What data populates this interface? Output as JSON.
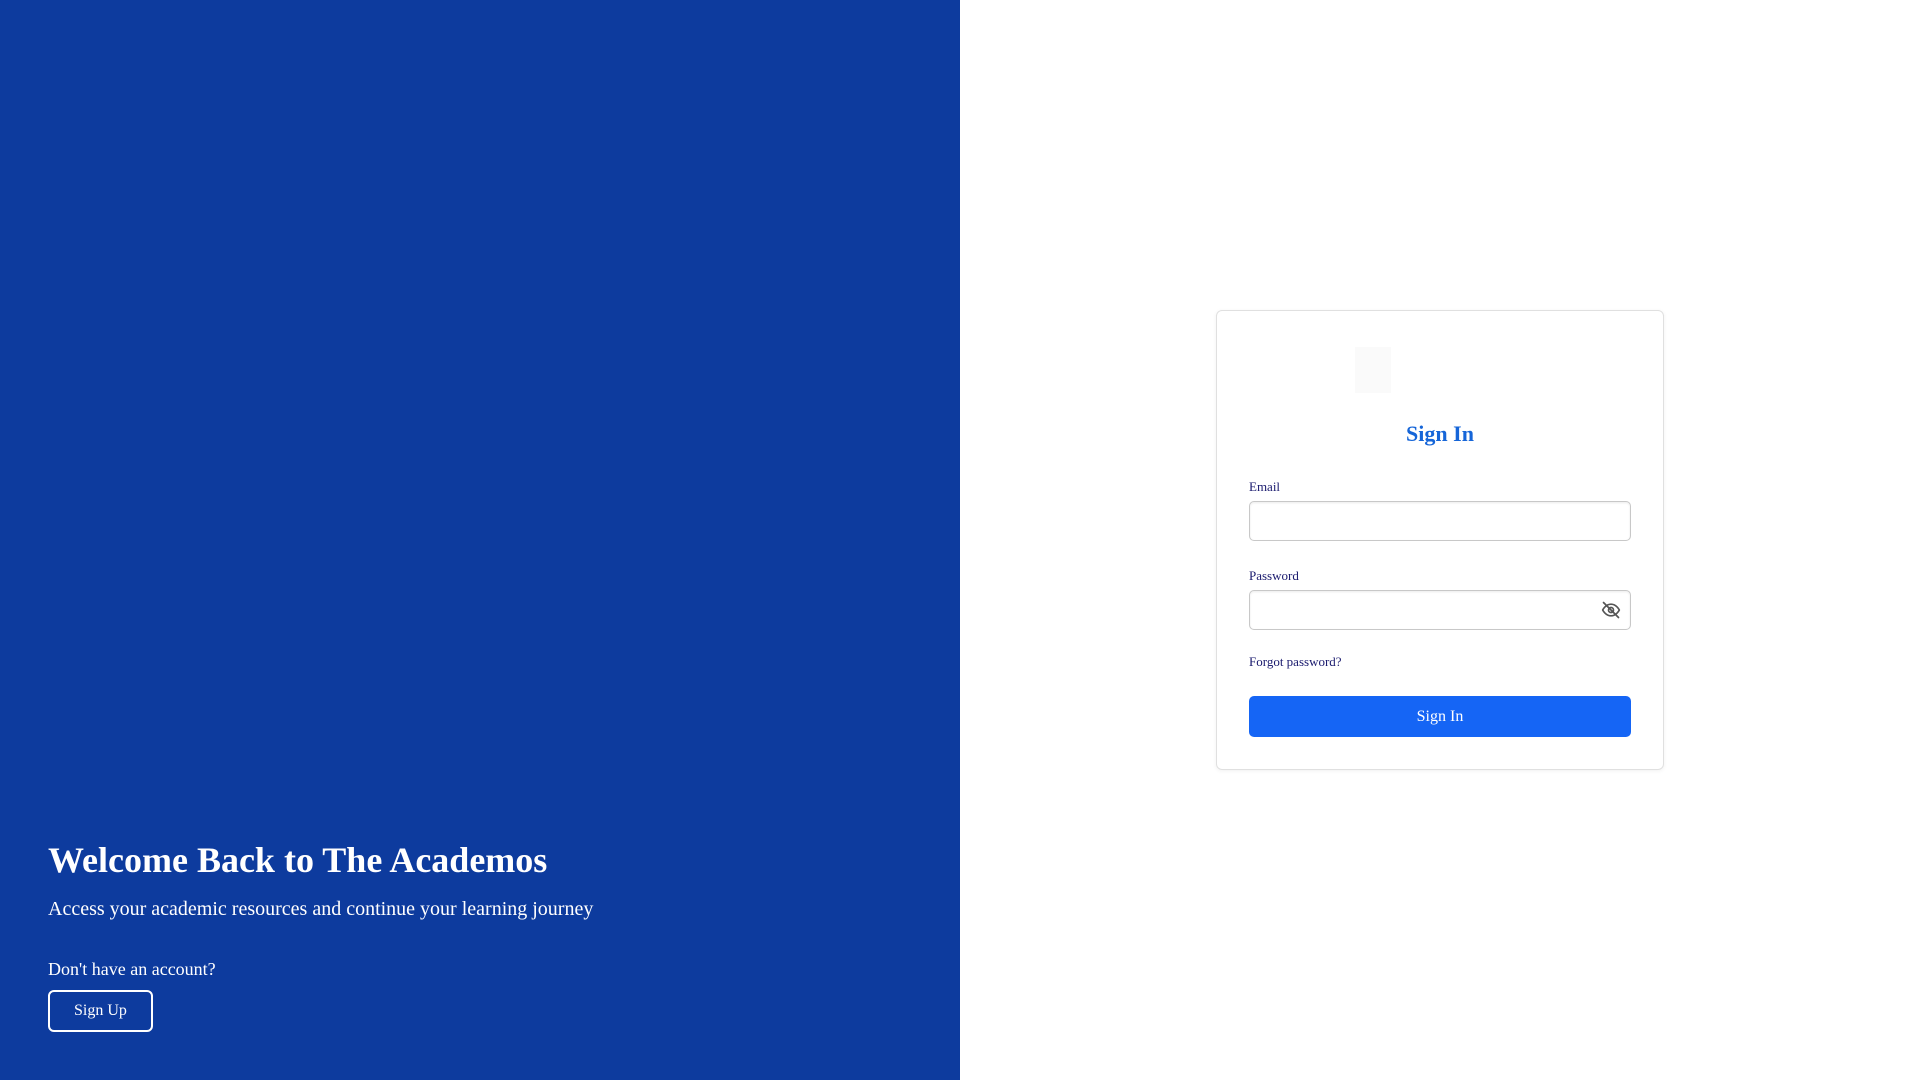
{
  "brand": {
    "primary_color": "#0d3b9e",
    "accent_color": "#1565f5"
  },
  "hero": {
    "title": "Welcome Back to The Academos",
    "subtitle": "Access your academic resources and continue your learning journey",
    "no_account_text": "Don't have an account?",
    "signup_label": "Sign Up"
  },
  "signin_form": {
    "title": "Sign In",
    "email_label": "Email",
    "email_value": "",
    "password_label": "Password",
    "password_value": "",
    "password_toggle_icon": "eye-off-icon",
    "forgot_password_label": "Forgot password?",
    "submit_label": "Sign In"
  }
}
